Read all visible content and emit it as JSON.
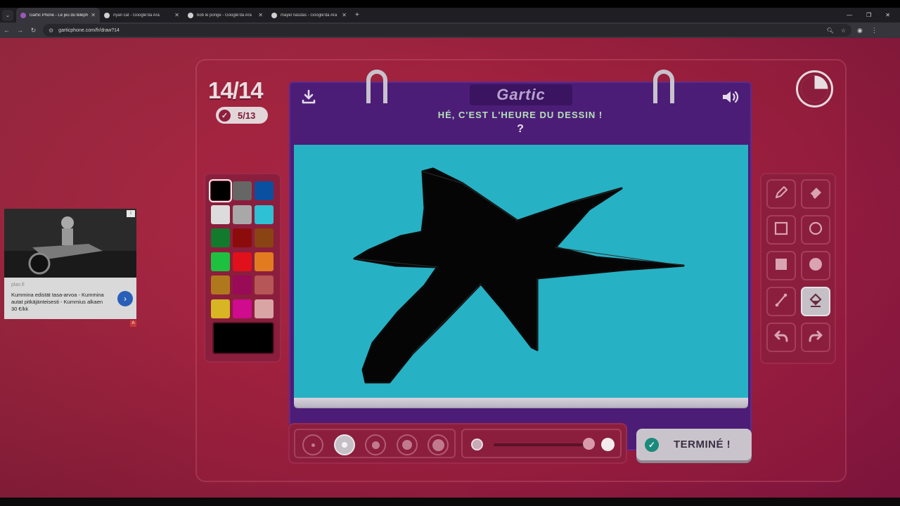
{
  "browser": {
    "tabs": [
      {
        "title": "Gartic Phone - Le jeu du téléph",
        "favicon_color": "#9b59b6",
        "active": true
      },
      {
        "title": "nyan cat - Google'da Ara",
        "favicon_color": "#cfcfcf",
        "active": false
      },
      {
        "title": "bob le ponge - Google'da Ara",
        "favicon_color": "#cfcfcf",
        "active": false
      },
      {
        "title": "mayel nasdas - Google'da Ara",
        "favicon_color": "#cfcfcf",
        "active": false
      }
    ],
    "url": "garticphone.com/fr/draw?14"
  },
  "game": {
    "round": "14/14",
    "score": "5/13",
    "logo": "Gartic",
    "title": "HÉ, C'EST L'HEURE DU DESSIN !",
    "prompt": "?",
    "done_label": "TERMINÉ !",
    "timer_elapsed_fraction": 0.25
  },
  "palette": {
    "colors": [
      "#000000",
      "#666666",
      "#0a50a1",
      "#dcdcdc",
      "#a8a8a8",
      "#2ec0d4",
      "#127a2c",
      "#8c0b0b",
      "#8a4313",
      "#1ec03f",
      "#e0111a",
      "#e27b20",
      "#b0781d",
      "#990a57",
      "#b75656",
      "#d8b522",
      "#cf0b8e",
      "#d8a4a4"
    ],
    "selected": "#000000",
    "current_color": "#000000"
  },
  "tools": [
    {
      "name": "pencil-tool",
      "icon": "pencil-icon"
    },
    {
      "name": "eraser-tool",
      "icon": "eraser-icon"
    },
    {
      "name": "rectangle-outline-tool",
      "icon": "square-outline-icon"
    },
    {
      "name": "ellipse-outline-tool",
      "icon": "circle-outline-icon"
    },
    {
      "name": "rectangle-fill-tool",
      "icon": "square-filled-icon"
    },
    {
      "name": "ellipse-fill-tool",
      "icon": "circle-filled-icon"
    },
    {
      "name": "line-tool",
      "icon": "line-icon"
    },
    {
      "name": "bucket-fill-tool",
      "icon": "bucket-icon",
      "selected": true
    },
    {
      "name": "undo-tool",
      "icon": "undo-icon"
    },
    {
      "name": "redo-tool",
      "icon": "redo-icon"
    }
  ],
  "brush": {
    "sizes": [
      1,
      2,
      3,
      4,
      5
    ],
    "selected_size_index": 1,
    "opacity_fraction": 1.0
  },
  "canvas": {
    "background": "#27b1c4",
    "drawing": "black star shape"
  },
  "ad": {
    "domain": "plan.fi",
    "text": "Kummina edistät tasa-arvoa - Kummina autat pitkäjänteisesti - Kummius alkaen 30 €/kk",
    "info": "i",
    "badge": "A"
  }
}
